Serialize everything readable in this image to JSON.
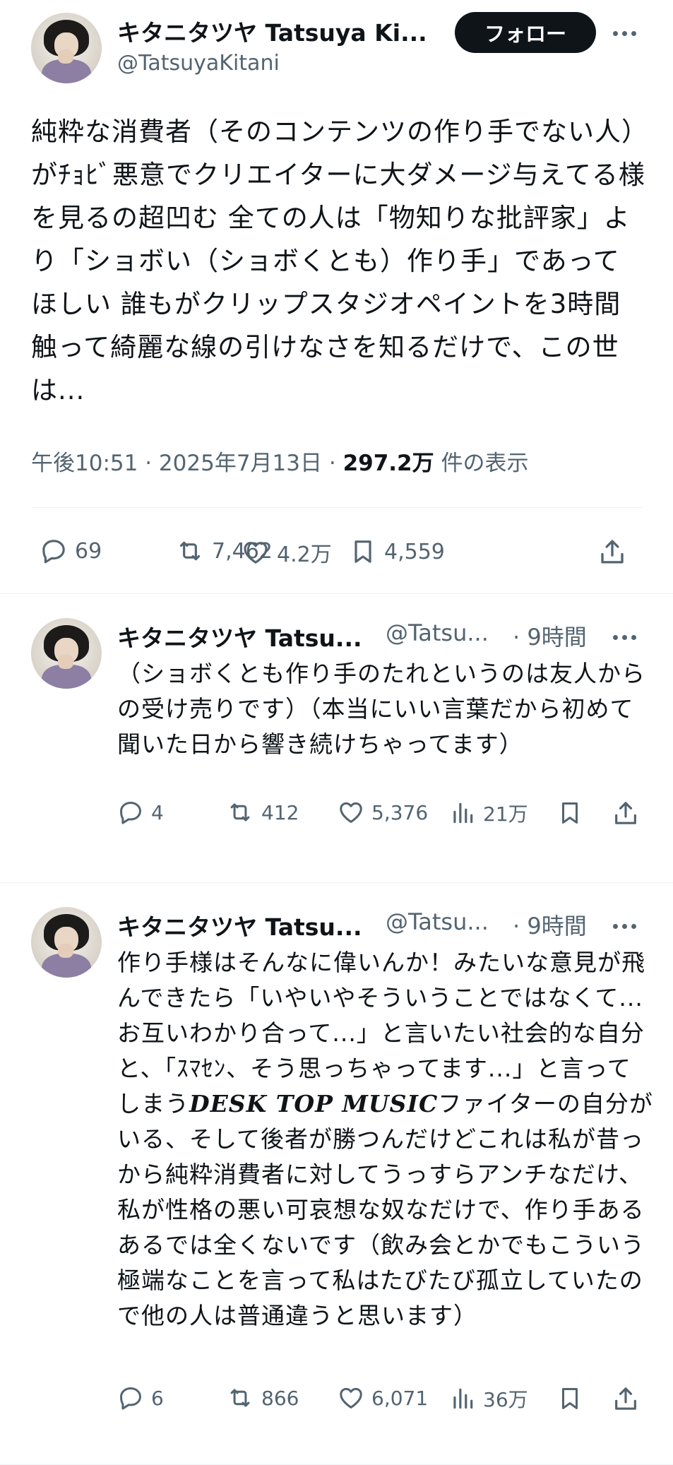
{
  "main_post": {
    "author_name": "キタニタツヤ Tatsuya Ki...",
    "author_handle": "@TatsuyaKitani",
    "follow_label": "フォロー",
    "text": "純粋な消費者（そのコンテンツの作り手でない人）がﾁｮﾋﾞ悪意でクリエイターに大ダメージ与えてる様を見るの超凹む 全ての人は「物知りな批評家」より「ショボい（ショボくとも）作り手」であってほしい 誰もがクリップスタジオペイントを3時間触って綺麗な線の引けなさを知るだけで、この世は...",
    "time": "午後10:51",
    "date": "2025年7月13日",
    "views_count": "297.2万",
    "views_label": "件の表示",
    "stats": {
      "replies": "69",
      "reposts": "7,462",
      "likes": "4.2万",
      "bookmarks": "4,559"
    }
  },
  "replies": [
    {
      "author_name": "キタニタツヤ Tatsu...",
      "author_handle": "@Tatsu...",
      "time": "· 9時間",
      "text": "（ショボくとも作り手のたれというのは友人からの受け売りです）（本当にいい言葉だから初めて聞いた日から響き続けちゃってます）",
      "stats": {
        "replies": "4",
        "reposts": "412",
        "likes": "5,376",
        "views": "21万"
      }
    },
    {
      "author_name": "キタニタツヤ Tatsu...",
      "author_handle": "@Tatsu...",
      "time": "· 9時間",
      "text_before": "作り手様はそんなに偉いんか！みたいな意見が飛んできたら「いやいやそういうことではなくて...お互いわかり合って...」と言いたい社会的な自分と、「ｽﾏｾﾝ、そう思っちゃってます...」と言ってしまう",
      "text_emphasis": "DESK TOP MUSIC",
      "text_after": "ファイターの自分がいる、そして後者が勝つんだけどこれは私が昔っから純粋消費者に対してうっすらアンチなだけ、私が性格の悪い可哀想な奴なだけで、作り手あるあるでは全くないです（飲み会とかでもこういう極端なことを言って私はたびたび孤立していたので他の人は普通違うと思います）",
      "stats": {
        "replies": "6",
        "reposts": "866",
        "likes": "6,071",
        "views": "36万"
      }
    }
  ],
  "icons": {
    "reply": "reply-icon",
    "repost": "repost-icon",
    "like": "heart-icon",
    "views": "analytics-icon",
    "bookmark": "bookmark-icon",
    "share": "share-icon",
    "more": "more-icon"
  },
  "colors": {
    "text": "#0f1419",
    "secondary": "#536471",
    "divider": "#eff3f4",
    "follow_bg": "#0f1419"
  }
}
